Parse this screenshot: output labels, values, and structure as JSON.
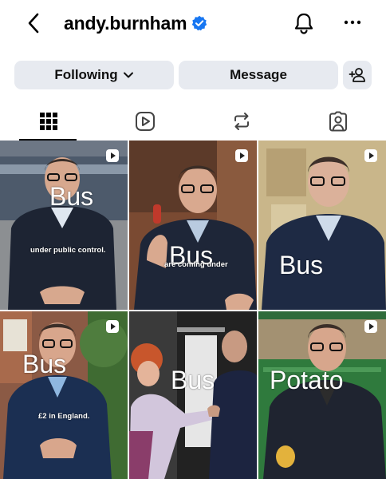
{
  "profile": {
    "username": "andy.burnham",
    "verified": true,
    "verified_color": "#1877f2"
  },
  "header": {
    "back_icon": "chevron-left-icon",
    "notifications_icon": "bell-icon",
    "more_icon": "more-horizontal-icon"
  },
  "actions": {
    "following_label": "Following",
    "message_label": "Message",
    "add_user_icon": "add-user-icon"
  },
  "tabs": [
    {
      "name": "posts",
      "icon": "grid-icon",
      "active": true
    },
    {
      "name": "reels",
      "icon": "play-icon",
      "active": false
    },
    {
      "name": "reposts",
      "icon": "repost-icon",
      "active": false
    },
    {
      "name": "tagged",
      "icon": "tagged-person-icon",
      "active": false
    }
  ],
  "grid": {
    "tiles": [
      {
        "overlay": "Bus",
        "caption": "under public control.",
        "reel": true
      },
      {
        "overlay": "Bus",
        "caption": "are coming under",
        "reel": true
      },
      {
        "overlay": "Bus",
        "caption": "",
        "reel": true
      },
      {
        "overlay": "Bus",
        "caption": "£2 in England.",
        "reel": true
      },
      {
        "overlay": "Bus",
        "caption": "",
        "reel": false
      },
      {
        "overlay": "Potato",
        "caption": "",
        "reel": true
      }
    ]
  }
}
